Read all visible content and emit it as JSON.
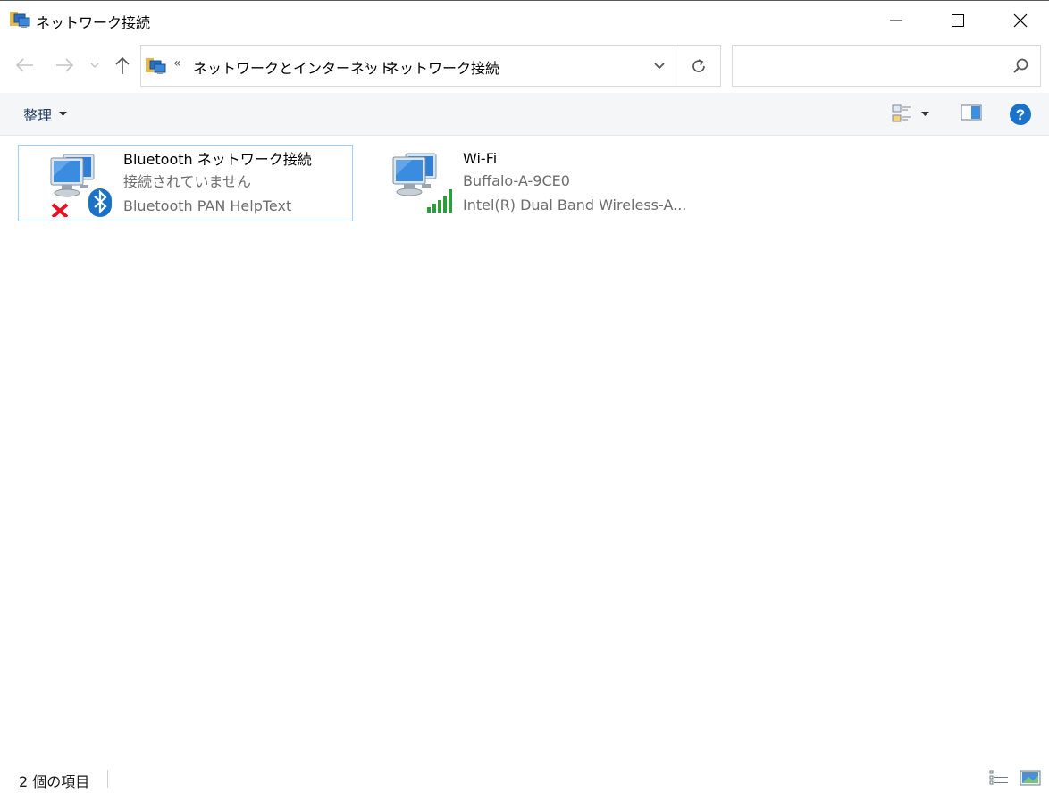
{
  "window": {
    "title": "ネットワーク接続"
  },
  "address": {
    "overflow_glyph": "«",
    "crumbs": [
      "ネットワークとインターネット",
      "ネットワーク接続"
    ],
    "separator": "›"
  },
  "search": {
    "placeholder": ""
  },
  "commandbar": {
    "organize_label": "整理"
  },
  "items": [
    {
      "name": "Bluetooth ネットワーク接続",
      "status": "接続されていません",
      "device": "Bluetooth PAN HelpText"
    },
    {
      "name": "Wi-Fi",
      "status": "Buffalo-A-9CE0",
      "device": "Intel(R) Dual Band Wireless-A..."
    }
  ],
  "statusbar": {
    "count_text": "2 個の項目"
  },
  "colors": {
    "accent": "#1a73c8",
    "selection_border": "#99d1ff",
    "error_red": "#e81123",
    "signal_green": "#2e9d3a"
  },
  "icons": {
    "title": "network-folder-icon",
    "back": "arrow-left-icon",
    "forward": "arrow-right-icon",
    "up": "arrow-up-icon",
    "refresh": "refresh-icon",
    "search": "search-icon",
    "help": "help-icon"
  }
}
